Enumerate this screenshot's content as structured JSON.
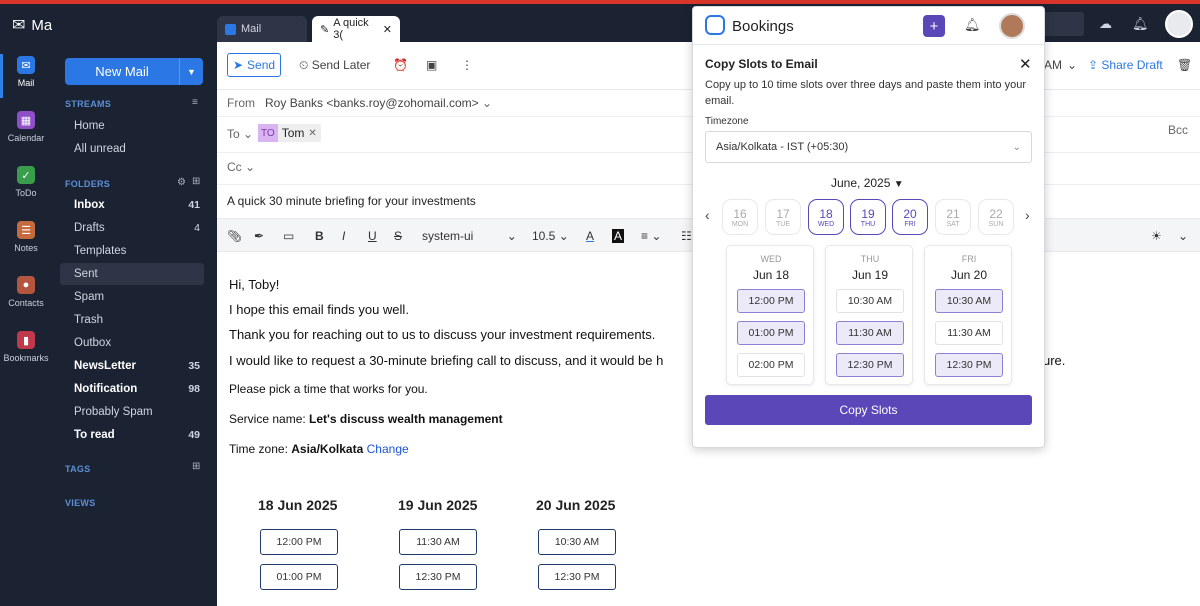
{
  "app": {
    "title": "Mail"
  },
  "rail": [
    {
      "label": "Mail",
      "icon": "mail-icon",
      "color": "#2b78e4"
    },
    {
      "label": "Calendar",
      "icon": "calendar-icon",
      "color": "#8e4fc8"
    },
    {
      "label": "ToDo",
      "icon": "todo-icon",
      "color": "#3a9d4b"
    },
    {
      "label": "Notes",
      "icon": "notes-icon",
      "color": "#c46a3c"
    },
    {
      "label": "Contacts",
      "icon": "contacts-icon",
      "color": "#b4553e"
    },
    {
      "label": "Bookmarks",
      "icon": "bookmarks-icon",
      "color": "#c0394b"
    }
  ],
  "sidebar": {
    "new_mail": "New Mail",
    "streams_title": "STREAMS",
    "streams": [
      {
        "label": "Home"
      },
      {
        "label": "All unread"
      }
    ],
    "folders_title": "FOLDERS",
    "folders": [
      {
        "label": "Inbox",
        "count": "41",
        "bold": true
      },
      {
        "label": "Drafts",
        "count": "4"
      },
      {
        "label": "Templates",
        "count": ""
      },
      {
        "label": "Sent",
        "count": "",
        "selected": true
      },
      {
        "label": "Spam",
        "count": ""
      },
      {
        "label": "Trash",
        "count": ""
      },
      {
        "label": "Outbox",
        "count": ""
      },
      {
        "label": "NewsLetter",
        "count": "35",
        "bold": true
      },
      {
        "label": "Notification",
        "count": "98",
        "bold": true
      },
      {
        "label": "Probably Spam",
        "count": ""
      },
      {
        "label": "To read",
        "count": "49",
        "bold": true
      }
    ],
    "tags_title": "TAGS",
    "views_title": "VIEWS"
  },
  "tabs": [
    {
      "label": "Mail"
    },
    {
      "label": "A quick 3("
    }
  ],
  "toolbar": {
    "send": "Send",
    "send_later": "Send Later",
    "am_fragment": "AM",
    "share_draft": "Share Draft"
  },
  "compose": {
    "from_label": "From",
    "from_value": "Roy Banks <banks.roy@zohomail.com>",
    "to_label": "To",
    "to_chip_initials": "TO",
    "to_chip_name": "Tom",
    "cc_label": "Cc",
    "bcc_label": "Bcc",
    "subject": "A quick 30 minute briefing for your investments"
  },
  "format": {
    "font": "system-ui",
    "size": "10.5"
  },
  "email_body": {
    "greeting": "Hi, Toby!",
    "line1": "I hope this email finds you well.",
    "line2": "Thank you for reaching out to us to discuss your investment requirements.",
    "line3a": "I would like to request a 30-minute briefing call to discuss, and it would be h",
    "line3b": "ure.",
    "line4": "Please pick a time that works for you.",
    "service_prefix": "Service name: ",
    "service_name": "Let's discuss wealth management",
    "tz_prefix": "Time zone: ",
    "tz_name": "Asia/Kolkata",
    "tz_change": "Change"
  },
  "slots": [
    {
      "date": "18 Jun 2025",
      "times": [
        "12:00 PM",
        "01:00 PM"
      ]
    },
    {
      "date": "19 Jun 2025",
      "times": [
        "11:30 AM",
        "12:30 PM"
      ]
    },
    {
      "date": "20 Jun 2025",
      "times": [
        "10:30 AM",
        "12:30 PM"
      ]
    }
  ],
  "bookings": {
    "title": "Bookings",
    "heading": "Copy Slots to Email",
    "description": "Copy up to 10 time slots over three days and paste them into your email.",
    "timezone_label": "Timezone",
    "timezone_value": "Asia/Kolkata - IST (+05:30)",
    "month": "June, 2025",
    "days": [
      {
        "num": "16",
        "wd": "MON",
        "active": false
      },
      {
        "num": "17",
        "wd": "TUE",
        "active": false
      },
      {
        "num": "18",
        "wd": "WED",
        "active": true
      },
      {
        "num": "19",
        "wd": "THU",
        "active": true
      },
      {
        "num": "20",
        "wd": "FRI",
        "active": true
      },
      {
        "num": "21",
        "wd": "SAT",
        "active": false
      },
      {
        "num": "22",
        "wd": "SUN",
        "active": false
      }
    ],
    "columns": [
      {
        "wd": "WED",
        "date": "Jun 18",
        "slots": [
          {
            "t": "12:00 PM",
            "sel": true
          },
          {
            "t": "01:00 PM",
            "sel": true
          },
          {
            "t": "02:00 PM",
            "sel": false
          }
        ]
      },
      {
        "wd": "THU",
        "date": "Jun 19",
        "slots": [
          {
            "t": "10:30 AM",
            "sel": false
          },
          {
            "t": "11:30 AM",
            "sel": true
          },
          {
            "t": "12:30 PM",
            "sel": true
          }
        ]
      },
      {
        "wd": "FRI",
        "date": "Jun 20",
        "slots": [
          {
            "t": "10:30 AM",
            "sel": true
          },
          {
            "t": "11:30 AM",
            "sel": false
          },
          {
            "t": "12:30 PM",
            "sel": true
          }
        ]
      }
    ],
    "copy_button": "Copy Slots"
  }
}
